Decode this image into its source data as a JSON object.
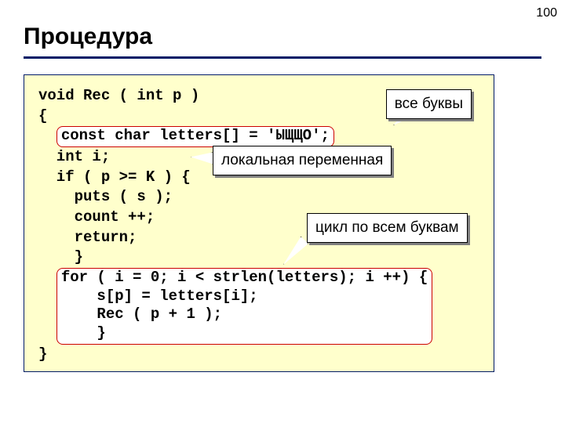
{
  "page_number": "100",
  "title": "Процедура",
  "code": {
    "l0_a": "void Rec ( int p )",
    "l1_a": "{",
    "l2_a": "  ",
    "l2_hl": "const char letters[] = 'ЫЩЩО';",
    "l3_a": "  int i;",
    "l4_a": "  if ( p >= K ) {",
    "l5_a": "    puts ( s );",
    "l6_a": "    count ++;",
    "l7_a": "    return;",
    "l8_a": "    }",
    "l9_a": "  ",
    "l9_hl1": "for ( i = 0; i < strlen(letters); i ++) {",
    "l10_hl": "    s[p] = letters[i];",
    "l11_hl": "    Rec ( p + 1 );",
    "l12_hl": "    }",
    "l13_a": "}"
  },
  "callouts": {
    "all_letters": "все буквы",
    "local_var": "локальная переменная",
    "loop": "цикл по всем буквам"
  }
}
